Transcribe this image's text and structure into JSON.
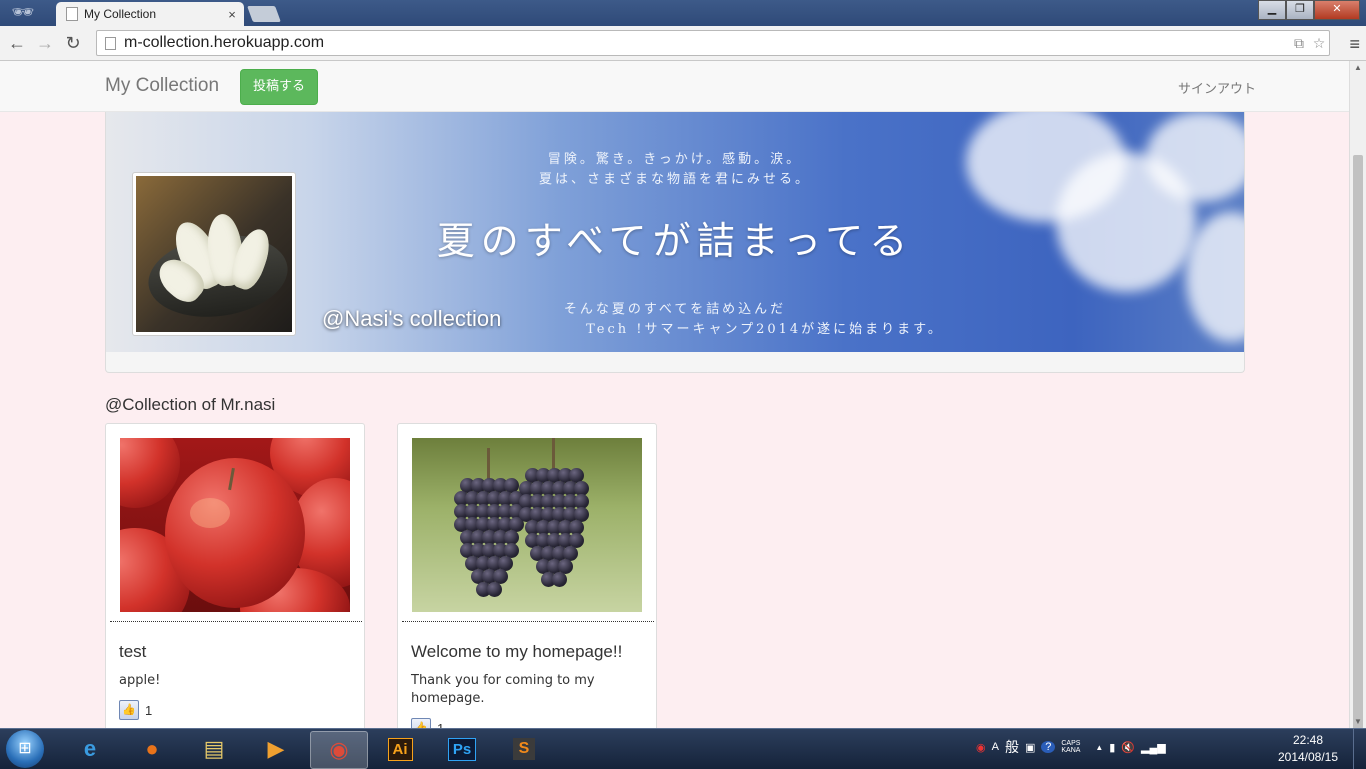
{
  "browser": {
    "tab_title": "My Collection",
    "tab_close": "×",
    "url": "m-collection.herokuapp.com",
    "window_controls": {
      "minimize": "▁",
      "maximize": "❐",
      "close": "✕"
    },
    "nav": {
      "back": "←",
      "forward": "→",
      "reload": "↻"
    },
    "omnibox_icons": [
      "translate-icon",
      "star-icon"
    ],
    "menu": "≡"
  },
  "navbar": {
    "brand": "My Collection",
    "post_button": "投稿する",
    "signout": "サインアウト"
  },
  "banner": {
    "tagline_line1": "冒険。驚き。きっかけ。感動。涙。",
    "tagline_line2": "夏は、さまざまな物語を君にみせる。",
    "headline": "夏のすべてが詰まってる",
    "sub_line1": "そんな夏のすべてを詰め込んだ",
    "sub_line2": "Tech !サマーキャンプ2014が遂に始まります。",
    "collection_title": "@Nasi's collection"
  },
  "section": {
    "heading": "@Collection of Mr.nasi"
  },
  "cards": [
    {
      "title": "test",
      "body": "apple!",
      "likes": "1",
      "image": "apples-photo"
    },
    {
      "title": "Welcome to my homepage!!",
      "body": "Thank you for coming to my homepage.",
      "likes": "1",
      "image": "grapes-photo"
    }
  ],
  "taskbar": {
    "start": "⊞",
    "apps": [
      {
        "name": "internet-explorer",
        "glyph": "e",
        "color": "#3a9be0"
      },
      {
        "name": "firefox",
        "glyph": "●",
        "color": "#e8731a"
      },
      {
        "name": "file-explorer",
        "glyph": "▤",
        "color": "#e6c96a"
      },
      {
        "name": "media-player",
        "glyph": "▶",
        "color": "#f0a030"
      },
      {
        "name": "chrome",
        "glyph": "◉",
        "color": "#dd4b39",
        "active": true
      },
      {
        "name": "illustrator",
        "glyph": "Ai",
        "color": "#f7a21b"
      },
      {
        "name": "photoshop",
        "glyph": "Ps",
        "color": "#2fa3f5"
      },
      {
        "name": "sublime-text",
        "glyph": "S",
        "color": "#f28a1b"
      }
    ],
    "tray": [
      "A",
      "般",
      "CAPS KANA",
      "▲"
    ],
    "time": "22:48",
    "date": "2014/08/15"
  }
}
